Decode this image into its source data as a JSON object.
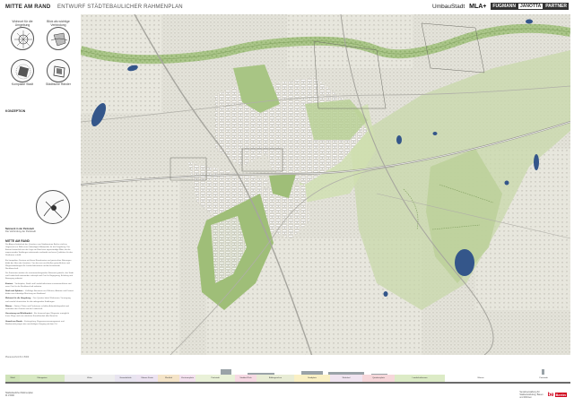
{
  "header": {
    "title": "MITTE AM RAND",
    "subtitle": "ENTWURF STÄDTEBAULICHER RAHMENPLAN",
    "logos": {
      "umbaustadt": "UmbauStadt",
      "mla": "MLA+",
      "fjp_1": "FUGMANN",
      "fjp_2": "JANOTTA",
      "fjp_3": "PARTNER"
    }
  },
  "diagrams": [
    {
      "label": "Wohnort für die Umgebung"
    },
    {
      "label": "Blick als wichtige Verbindung"
    },
    {
      "label": "Kompakte Stadt"
    },
    {
      "label": "Städtische Ränder"
    }
  ],
  "left_panel": {
    "diagram_heading": "KONZEPTION",
    "caption_title": "Netzwerk in der Parkstadt",
    "caption_sub": "Die Verbindung der Parkstadt",
    "section_heading": "MITTE AM RAND",
    "paragraphs": [
      "Die Abgeschiedenheit des Quartiers vom Stadtzentrum Berlins steht im Gegensatz zur Rolle eines lebendigen Mittelpunkts für die Umgebung. Der Entwurf entwickelt aus der Lage am Rand eine eigenständige Mitte, die die angrenzenden Siedlungen miteinander verbindet und neue Qualitäten für den Stadtraum schafft.",
      "Ein kompaktes Zentrum mit klaren Raumkanten und gemischten Nutzungen bildet das Herz des Quartiers. Von hier aus erschließen grüne Achsen und Wegeverbindungen die Landschaftsräume und die bestehende Nachbarschaft.",
      "Die Freiräume werden als zusammenhängendes Netzwerk gedacht, das Stadt und Landschaft miteinander verknüpft und Orte für Begegnung, Erholung und Bewegung anbietet."
    ],
    "subsections": [
      {
        "title": "Kontext",
        "text": "Verknüpfen, Stadt- und Landschaftsräume zusammenführen und neue Orte für die Nachbarschaft anbieten."
      },
      {
        "title": "Stadt und Sphären",
        "text": "Vielfältige Bausteine aus Wohnen, Arbeiten und Freizeit bilden eine lebendige Mischung am Stadtrand."
      },
      {
        "title": "Wohnort für die Umgebung",
        "text": "Das Quartier bietet Wohnraum, Versorgung und soziale Infrastruktur für die umliegenden Siedlungen."
      },
      {
        "title": "Räume",
        "text": "Gärten, Plätze und Parkräume schaffen Aufenthaltsqualität und verbinden das Zentrum mit der Landschaft."
      },
      {
        "title": "Vernetzung und Erlebbarkeit",
        "text": "Ein feinmaschiges Wegenetz ermöglicht kurze Wege und eine attraktive Erreichbarkeit aller Bereiche."
      },
      {
        "title": "Umwelt am Rande",
        "text": "Entsiegelung, Regenwassermanagement und Biodiversität prägen den nachhaltigen Umgang mit dem Ort."
      }
    ]
  },
  "section_strip": {
    "zones": [
      {
        "label": "Wald",
        "color": "#cfe3b8"
      },
      {
        "label": "Kleingarten",
        "color": "#d7e8c2"
      },
      {
        "label": "Wohn",
        "color": "#eeeeee"
      },
      {
        "label": "Gewerbehöfe",
        "color": "#e8e4f0"
      },
      {
        "label": "Urbane Kante",
        "color": "#ece3f1"
      },
      {
        "label": "Werkhof",
        "color": "#f4e4c8"
      },
      {
        "label": "Zentrumsplatz",
        "color": "#f3e1ee"
      },
      {
        "label": "Parkstadt",
        "color": "#e9f1d8"
      },
      {
        "label": "Stadtteil-Park",
        "color": "#f6d9e3"
      },
      {
        "label": "Bildungsachse",
        "color": "#e8ecd5"
      },
      {
        "label": "Stadtplatz",
        "color": "#faf0c4"
      },
      {
        "label": "Wohnhof",
        "color": "#f0e4f0"
      },
      {
        "label": "Quartiersplatz",
        "color": "#f6d7da"
      },
      {
        "label": "Landschaftsraum",
        "color": "#dcebc6"
      },
      {
        "label": "Wiesen",
        "color": "#ffffff"
      },
      {
        "label": "Parkstadt",
        "color": "#ffffff"
      }
    ]
  },
  "footer": {
    "left_line1": "Städtebaulicher Rahmenplan",
    "left_line2": "M 1:5000",
    "right_line1": "Senatsverwaltung für",
    "right_line2": "Stadtentwicklung, Bauen",
    "right_line3": "und Wohnen",
    "berlin": "be",
    "berlin_tag": "Berlin"
  },
  "notice": "Planausschnitt M 1:5000"
}
